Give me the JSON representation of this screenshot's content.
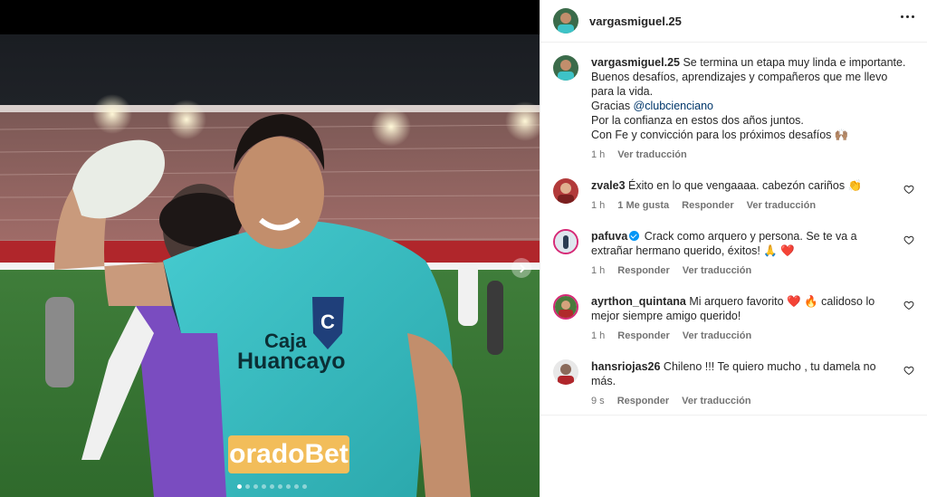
{
  "post": {
    "author": "vargasmiguel.25",
    "caption_lines": [
      "Se termina un etapa muy linda e importante.",
      "Buenos desafíos, aprendizajes y compañeros que me llevo para la vida.",
      "Gracias ",
      "Por la confianza en estos dos años juntos.",
      "Con Fe y convicción para los próximos desafíos 🙌🏽"
    ],
    "mention": "@clubcienciano",
    "caption_time": "1 h",
    "see_translation": "Ver traducción"
  },
  "jersey": {
    "sponsor_line1": "Caja",
    "sponsor_line2": "Huancayo",
    "sponsor_bottom": "oradoBet"
  },
  "comments": [
    {
      "user": "zvale3",
      "text": "Éxito en lo que vengaaaa. cabezón cariños 👏",
      "time": "1 h",
      "likes": "1 Me gusta",
      "reply": "Responder",
      "translate": "Ver traducción"
    },
    {
      "user": "pafuva",
      "verified": true,
      "text": "Crack como arquero y persona. Se te va a extrañar hermano querido, éxitos! 🙏 ❤️",
      "time": "1 h",
      "reply": "Responder",
      "translate": "Ver traducción"
    },
    {
      "user": "ayrthon_quintana",
      "text": "Mi arquero favorito ❤️ 🔥 calidoso lo mejor siempre amigo querido!",
      "time": "1 h",
      "reply": "Responder",
      "translate": "Ver traducción"
    },
    {
      "user": "hansriojas26",
      "text": "Chileno !!! Te quiero mucho , tu damela no más.",
      "time": "9 s",
      "reply": "Responder",
      "translate": "Ver traducción"
    }
  ],
  "carousel": {
    "total": 9,
    "current": 1
  },
  "colors": {
    "jersey": "#3ec3c7",
    "link": "#00376b",
    "meta": "#737373",
    "like_red": "#ed4956"
  }
}
